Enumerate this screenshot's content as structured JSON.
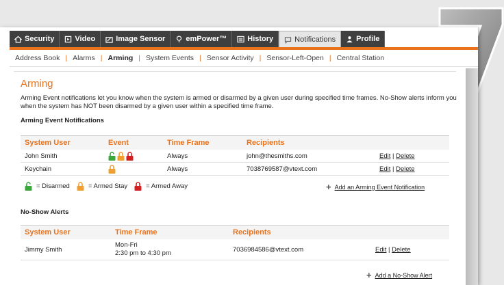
{
  "step_number": "7",
  "tabs": [
    {
      "label": "Security",
      "icon": "home-icon"
    },
    {
      "label": "Video",
      "icon": "video-icon"
    },
    {
      "label": "Image Sensor",
      "icon": "image-sensor-icon"
    },
    {
      "label": "emPower™",
      "icon": "bulb-icon"
    },
    {
      "label": "History",
      "icon": "history-icon"
    },
    {
      "label": "Notifications",
      "icon": "chat-bubble-icon"
    },
    {
      "label": "Profile",
      "icon": "person-icon"
    }
  ],
  "subnav": [
    "Address Book",
    "Alarms",
    "Arming",
    "System Events",
    "Sensor Activity",
    "Sensor-Left-Open",
    "Central Station"
  ],
  "page_title": "Arming",
  "description": "Arming Event notifications let you know when the system is armed or disarmed by a given user during specified time frames. No-Show alerts inform you when the system has NOT been disarmed by a given user within a specified time frame.",
  "arming": {
    "section_title": "Arming Event Notifications",
    "headers": [
      "System User",
      "Event",
      "Time Frame",
      "Recipients"
    ],
    "rows": [
      {
        "user": "John Smith",
        "time": "Always",
        "recipients": "john@thesmiths.com",
        "edit": "Edit",
        "delete": "Delete"
      },
      {
        "user": "Keychain",
        "time": "Always",
        "recipients": "7038769587@vtext.com",
        "edit": "Edit",
        "delete": "Delete"
      }
    ],
    "legend": [
      "= Disarmed",
      "= Armed Stay",
      "= Armed Away"
    ],
    "add_label": "Add an Arming Event Notification"
  },
  "noshow": {
    "section_title": "No-Show Alerts",
    "headers": [
      "System User",
      "Time Frame",
      "Recipients"
    ],
    "rows": [
      {
        "user": "Jimmy Smith",
        "days": "Mon-Fri",
        "hours": "2:30 pm to 4:30 pm",
        "recipients": "7036984586@vtext.com",
        "edit": "Edit",
        "delete": "Delete"
      }
    ],
    "add_label": "Add a No-Show Alert"
  },
  "colors": {
    "accent": "#e8731c",
    "disarmed": "#3aa83a",
    "armed_stay": "#f0a030",
    "armed_away": "#d42020",
    "tab_dark": "#3f3f3f"
  }
}
